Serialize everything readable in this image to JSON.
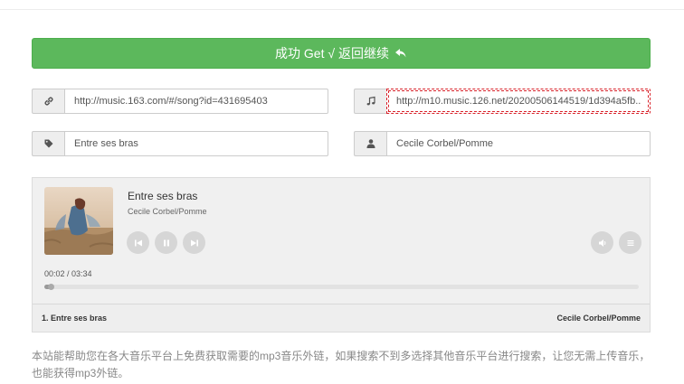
{
  "header": {
    "success_label": "成功 Get √ 返回继续"
  },
  "form": {
    "song_url": "http://music.163.com/#/song?id=431695403",
    "mp3_url": "http://m10.music.126.net/20200506144519/1d394a5fb...",
    "title": "Entre ses bras",
    "artist": "Cecile Corbel/Pomme"
  },
  "icons": {
    "url": "link-icon",
    "mp3": "music-note-icon",
    "title": "tag-icon",
    "artist": "user-icon"
  },
  "player": {
    "title": "Entre ses bras",
    "artist": "Cecile Corbel/Pomme",
    "time": "00:02 / 03:34",
    "progress": 0.01,
    "playlist": {
      "item": "1. Entre ses bras",
      "artist": "Cecile Corbel/Pomme"
    }
  },
  "footer": {
    "text": "本站能帮助您在各大音乐平台上免费获取需要的mp3音乐外链，如果搜索不到多选择其他音乐平台进行搜索，让您无需上传音乐，也能获得mp3外链。"
  },
  "colors": {
    "success": "#5cb85c",
    "highlight_border": "#d9232b"
  }
}
